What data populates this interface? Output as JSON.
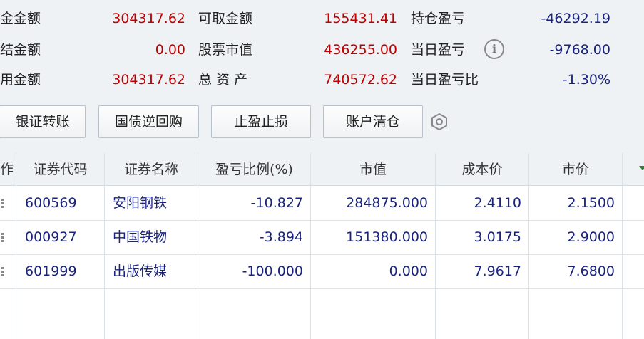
{
  "summary": {
    "row1": {
      "l1": "金金额",
      "v1": "304317.62",
      "l2": "可取金额",
      "v2": "155431.41",
      "l3": "持仓盈亏",
      "v3": "-46292.19"
    },
    "row2": {
      "l1": "结金额",
      "v1": "0.00",
      "l2": "股票市值",
      "v2": "436255.00",
      "l3": "当日盈亏",
      "v3": "-9768.00"
    },
    "row3": {
      "l1": "用金额",
      "v1": "304317.62",
      "l2": "总 资 产",
      "v2": "740572.62",
      "l3": "当日盈亏比",
      "v3": "-1.30%"
    },
    "info_icon": "i"
  },
  "buttons": {
    "transfer": "银证转账",
    "repo": "国债逆回购",
    "stop": "止盈止损",
    "clear": "账户清仓"
  },
  "table": {
    "headers": [
      "作",
      "证券代码",
      "证券名称",
      "盈亏比例(%)",
      "市值",
      "成本价",
      "市价"
    ],
    "rows": [
      {
        "code": "600569",
        "name": "安阳钢铁",
        "pl_pct": "-10.827",
        "mkt_value": "284875.000",
        "cost": "2.4110",
        "price": "2.1500"
      },
      {
        "code": "000927",
        "name": "中国铁物",
        "pl_pct": "-3.894",
        "mkt_value": "151380.000",
        "cost": "3.0175",
        "price": "2.9000"
      },
      {
        "code": "601999",
        "name": "出版传媒",
        "pl_pct": "-100.000",
        "mkt_value": "0.000",
        "cost": "7.9617",
        "price": "7.6800"
      }
    ]
  },
  "colors": {
    "positive_red": "#c00000",
    "data_blue": "#1a237e",
    "panel_bg": "#eef2f5"
  }
}
